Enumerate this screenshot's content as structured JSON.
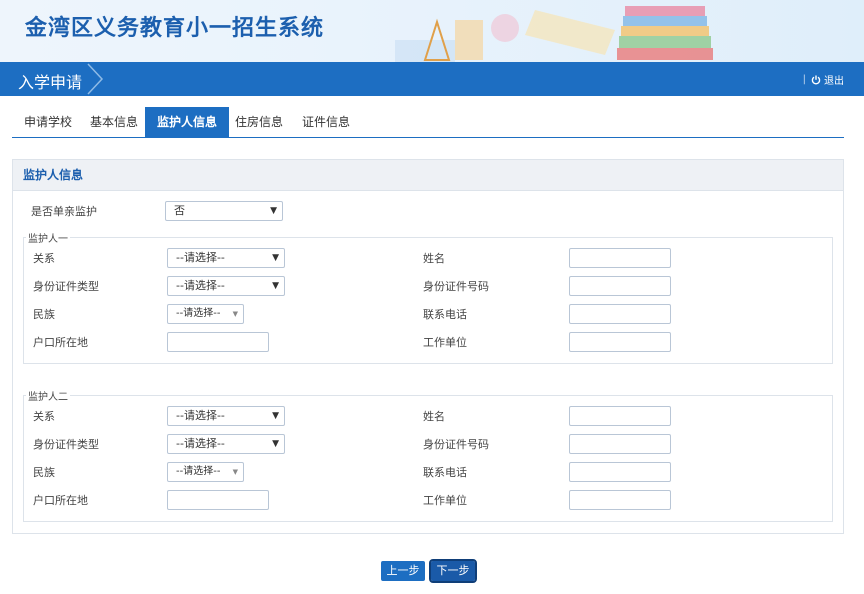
{
  "header": {
    "system_title": "金湾区义务教育小一招生系统"
  },
  "nav": {
    "section_title": "入学申请",
    "logout_label": "退出",
    "separator": "|"
  },
  "tabs": [
    "申请学校",
    "基本信息",
    "监护人信息",
    "住房信息",
    "证件信息"
  ],
  "active_tab": "监护人信息",
  "panel": {
    "title": "监护人信息",
    "single_parent_label": "是否单亲监护",
    "single_parent_value": "否"
  },
  "guardian1": {
    "legend": "监护人一",
    "relation_label": "关系",
    "relation_value": "--请选择--",
    "id_type_label": "身份证件类型",
    "id_type_value": "--请选择--",
    "ethnicity_label": "民族",
    "ethnicity_value": "--请选择--",
    "hukou_label": "户口所在地",
    "name_label": "姓名",
    "id_number_label": "身份证件号码",
    "phone_label": "联系电话",
    "employer_label": "工作单位"
  },
  "guardian2": {
    "legend": "监护人二",
    "relation_label": "关系",
    "relation_value": "--请选择--",
    "id_type_label": "身份证件类型",
    "id_type_value": "--请选择--",
    "ethnicity_label": "民族",
    "ethnicity_value": "--请选择--",
    "hukou_label": "户口所在地",
    "name_label": "姓名",
    "id_number_label": "身份证件号码",
    "phone_label": "联系电话",
    "employer_label": "工作单位"
  },
  "buttons": {
    "prev_label": "上一步",
    "next_label": "下一步"
  },
  "colors": {
    "primary": "#1d6ec2",
    "title": "#1c5fae"
  }
}
